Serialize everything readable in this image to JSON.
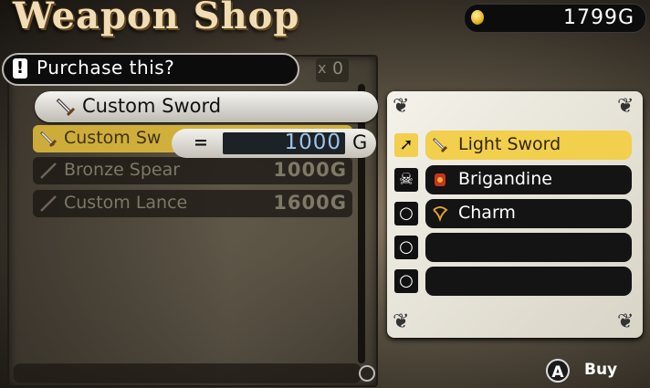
{
  "header": {
    "title": "Weapon Shop",
    "gold": "1799G"
  },
  "prompt": {
    "icon": "!",
    "text": "Purchase this?",
    "owned_count": "0",
    "owned_prefix": "x"
  },
  "selected": {
    "name": "Custom Sword",
    "icon": "sword-icon"
  },
  "cost": {
    "equals": "=",
    "value": "1000",
    "unit": "G"
  },
  "shop_items": [
    {
      "name": "Custom Sw",
      "price": "",
      "icon": "sword-icon",
      "state": "highlighted"
    },
    {
      "name": "Bronze Spear",
      "price": "1000G",
      "icon": "spear-icon",
      "state": "dimmed"
    },
    {
      "name": "Custom Lance",
      "price": "1600G",
      "icon": "lance-icon",
      "state": "dimmed"
    }
  ],
  "equipment": [
    {
      "slot_icon": "weapon-slot-icon",
      "item": "Light Sword",
      "item_icon": "sword-icon",
      "active": true
    },
    {
      "slot_icon": "armor-slot-icon",
      "item": "Brigandine",
      "item_icon": "armor-icon",
      "active": false
    },
    {
      "slot_icon": "accessory-slot-icon",
      "item": "Charm",
      "item_icon": "charm-icon",
      "active": false
    },
    {
      "slot_icon": "accessory-slot-icon",
      "item": "",
      "item_icon": "",
      "active": false
    },
    {
      "slot_icon": "accessory-slot-icon",
      "item": "",
      "item_icon": "",
      "active": false
    }
  ],
  "controls": {
    "button": "A",
    "action": "Buy"
  },
  "colors": {
    "highlight": "#f2cf4c",
    "cost_text": "#9cc4e6",
    "dark": "#141414"
  }
}
